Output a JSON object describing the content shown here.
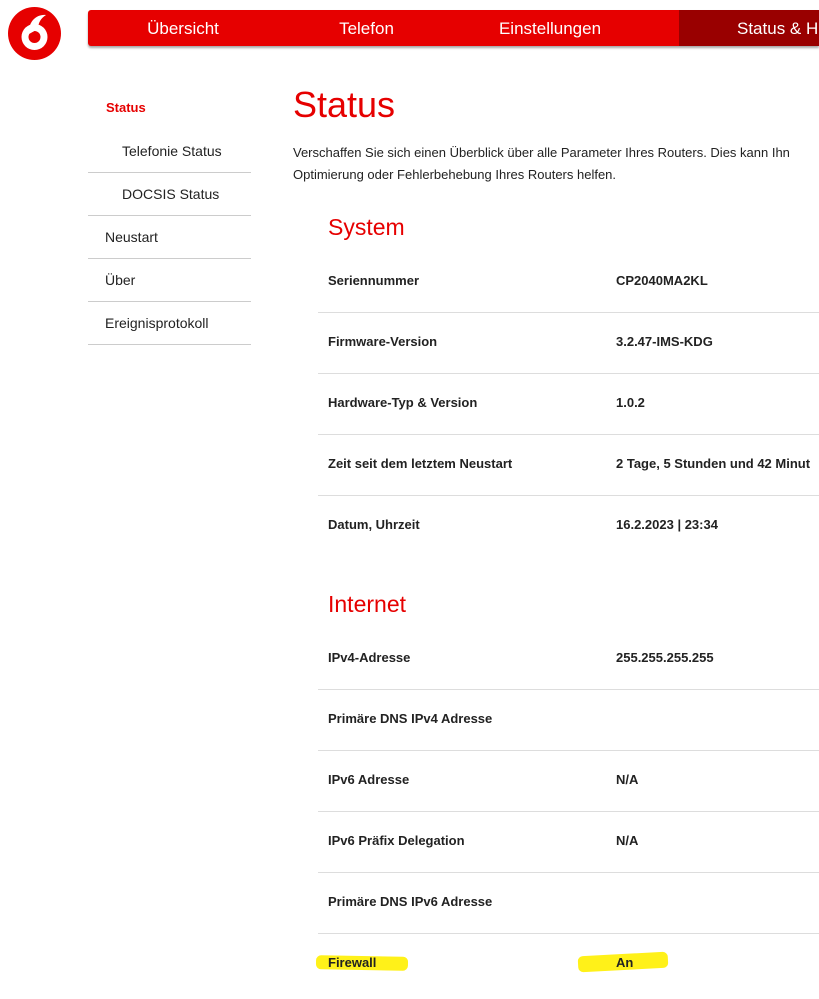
{
  "brand": {
    "logo_icon": "vodafone-speechmark-icon",
    "primary_color": "#e60000",
    "active_nav_color": "#990000"
  },
  "nav": {
    "items": [
      {
        "label": "Übersicht"
      },
      {
        "label": "Telefon"
      },
      {
        "label": "Einstellungen"
      },
      {
        "label": "Status & H"
      }
    ]
  },
  "sidebar": {
    "items": [
      {
        "label": "Status"
      },
      {
        "label": "Telefonie Status"
      },
      {
        "label": "DOCSIS Status"
      },
      {
        "label": "Neustart"
      },
      {
        "label": "Über"
      },
      {
        "label": "Ereignisprotokoll"
      }
    ]
  },
  "main": {
    "title": "Status",
    "intro_line1": "Verschaffen Sie sich einen Überblick über alle Parameter Ihres Routers. Dies kann Ihn",
    "intro_line2": "Optimierung oder Fehlerbehebung Ihres Routers helfen.",
    "system": {
      "title": "System",
      "rows": [
        {
          "label": "Seriennummer",
          "value": "CP2040MA2KL"
        },
        {
          "label": "Firmware-Version",
          "value": "3.2.47-IMS-KDG"
        },
        {
          "label": "Hardware-Typ & Version",
          "value": "1.0.2"
        },
        {
          "label": "Zeit seit dem letztem Neustart",
          "value": "2 Tage, 5 Stunden und 42 Minut"
        },
        {
          "label": "Datum, Uhrzeit",
          "value": "16.2.2023 | 23:34"
        }
      ]
    },
    "internet": {
      "title": "Internet",
      "rows": [
        {
          "label": "IPv4-Adresse",
          "value": "255.255.255.255"
        },
        {
          "label": "Primäre DNS IPv4 Adresse",
          "value": ""
        },
        {
          "label": "IPv6 Adresse",
          "value": "N/A"
        },
        {
          "label": "IPv6 Präfix Delegation",
          "value": "N/A"
        },
        {
          "label": "Primäre DNS IPv6 Adresse",
          "value": ""
        },
        {
          "label": "Firewall",
          "value": "An"
        }
      ]
    }
  },
  "annotation": {
    "highlight_color": "#ffef00"
  }
}
